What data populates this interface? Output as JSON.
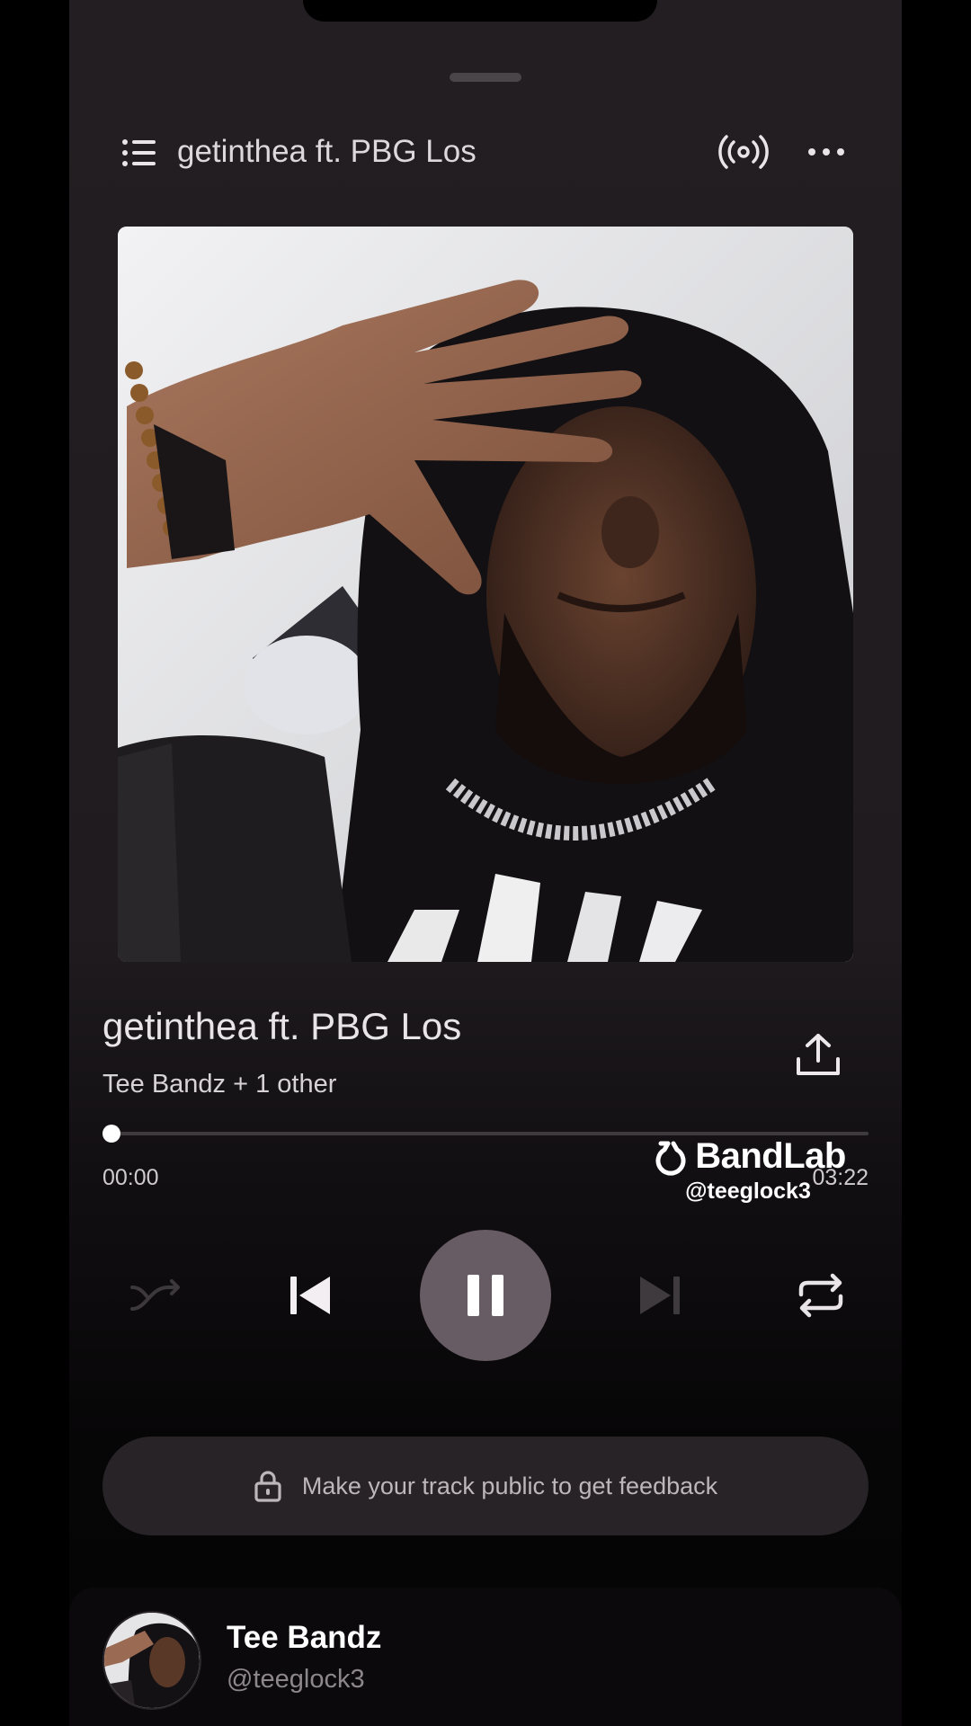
{
  "header": {
    "title": "getinthea ft. PBG Los",
    "queue_icon": "queue-list-icon",
    "broadcast_icon": "broadcast-icon",
    "more_icon": "more-horizontal-icon"
  },
  "track": {
    "title": "getinthea ft. PBG Los",
    "artist": "Tee Bandz + 1 other",
    "share_icon": "share-upload-icon"
  },
  "progress": {
    "elapsed": "00:00",
    "total": "03:22",
    "fraction": 0.0
  },
  "watermark": {
    "brand": "BandLab",
    "handle": "@teeglock3"
  },
  "controls": {
    "shuffle_icon": "shuffle-icon",
    "previous_icon": "skip-previous-icon",
    "play_state": "playing",
    "pause_icon": "pause-icon",
    "next_icon": "skip-next-icon",
    "repeat_icon": "repeat-icon"
  },
  "feedback": {
    "text": "Make your track public to get feedback",
    "icon": "lock-icon"
  },
  "artist_card": {
    "name": "Tee Bandz",
    "handle": "@teeglock3"
  },
  "colors": {
    "background": "#1f1b1f",
    "play_button": "#675b64",
    "pill": "#272326",
    "muted_text": "#8d878b"
  }
}
